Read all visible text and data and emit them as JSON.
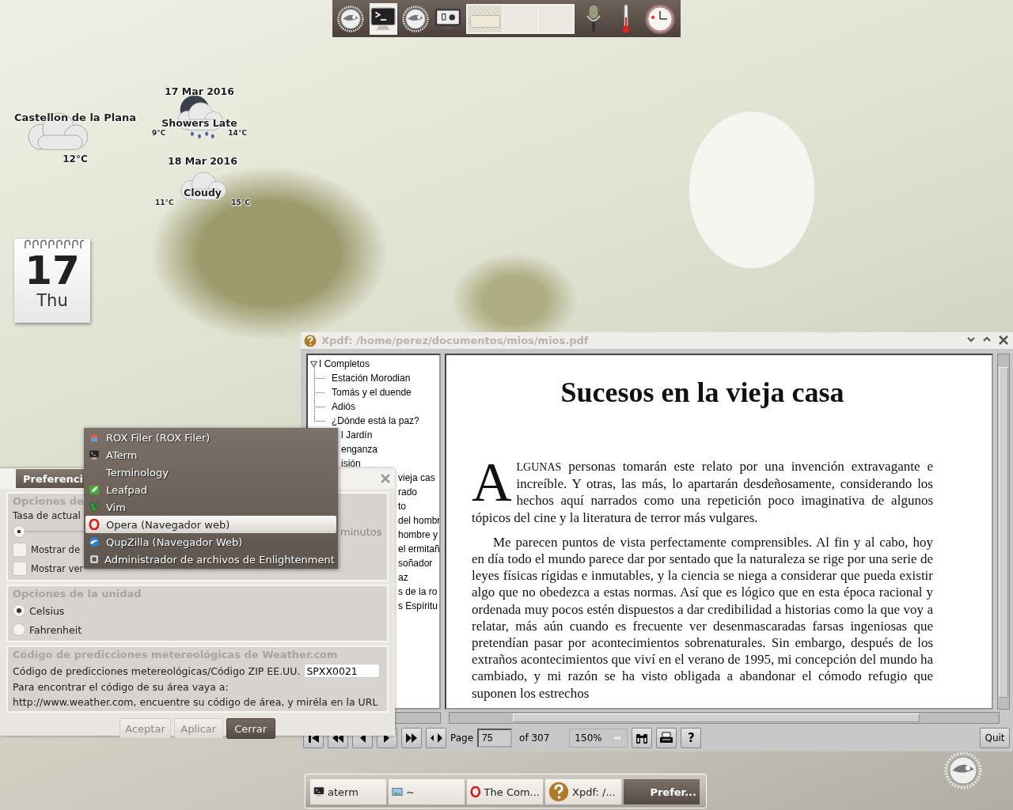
{
  "top_shelf": {
    "launchers": [
      {
        "kind": "gecko",
        "selected": false
      },
      {
        "kind": "terminal",
        "selected": true
      },
      {
        "kind": "gecko",
        "selected": false
      },
      {
        "kind": "monitor",
        "selected": false
      }
    ],
    "pager": [
      {
        "selected": true
      },
      {
        "selected": false
      },
      {
        "selected": false
      }
    ],
    "gadgets": [
      {
        "kind": "microphone"
      },
      {
        "kind": "thermometer"
      },
      {
        "kind": "clock"
      }
    ]
  },
  "weather": {
    "location": "Castellon de la Plana",
    "temperature": "12°C",
    "forecast": [
      {
        "date": "17 Mar 2016",
        "condition": "Showers Late",
        "kind": "rain",
        "low": "9°C",
        "high": "14°C"
      },
      {
        "date": "18 Mar 2016",
        "condition": "Cloudy",
        "kind": "cloud",
        "low": "11°C",
        "high": "15°C"
      }
    ]
  },
  "calendar": {
    "day": "17",
    "weekday": "Thu"
  },
  "xpdf": {
    "title": "Xpdf: /home/perez/documentos/mios/mios.pdf",
    "outline": [
      {
        "label": "I Completos",
        "expanded": true,
        "children": [
          {
            "label": "Estación Morodian",
            "kind": "entry"
          },
          {
            "label": "Tomás y el duende",
            "kind": "entry"
          },
          {
            "label": "Adiós",
            "kind": "entry"
          },
          {
            "label": "¿Dónde está la paz?",
            "kind": "entry"
          },
          {
            "label": "l Jardín",
            "kind": "partial"
          },
          {
            "label": "enganza",
            "kind": "partial"
          },
          {
            "label": "isión",
            "kind": "partial"
          },
          {
            "label": "vieja cas",
            "kind": "partial"
          },
          {
            "label": "rado",
            "kind": "partial"
          },
          {
            "label": "to",
            "kind": "partial"
          },
          {
            "label": "del hombr",
            "kind": "partial"
          },
          {
            "label": "hombre y",
            "kind": "partial"
          },
          {
            "label": "el ermitañ",
            "kind": "partial"
          },
          {
            "label": "soñador",
            "kind": "partial"
          },
          {
            "label": "az",
            "kind": "partial"
          },
          {
            "label": "s de la ro",
            "kind": "partial"
          },
          {
            "label": "s Espíritu",
            "kind": "partial"
          }
        ]
      }
    ],
    "page": {
      "title": "Sucesos en la vieja casa",
      "paragraphs": [
        {
          "dropcap": "A",
          "smallcaps": "LGUNAS",
          "text": " personas tomarán este relato por una invención extravagante e increíble. Y otras, las más, lo apartarán desdeñosamente, considerando los hechos aquí narrados como una repetición poco imaginativa de algunos tópicos del cine y la literatura de terror más vulgares."
        },
        {
          "text": "Me parecen puntos de vista perfectamente comprensibles. Al fin y al cabo, hoy en día todo el mundo parece dar por sentado que la naturaleza se rige por una serie de leyes físicas rígidas e inmutables, y la ciencia se niega a considerar que pueda existir algo que no obedezca a estas normas. Así que es lógico que en esta época racional y ordenada muy pocos estén dispuestos a dar credibilidad a historias como la que voy a relatar, más aún cuando es frecuente ver desenmascaradas farsas ingeniosas que pretendían pasar por acontecimientos sobrenaturales. Sin embargo, después de los extraños acontecimientos que viví en el verano de 1995, mi concepción del mundo ha cambiado, y mi razón se ha visto obligada a abandonar el cómodo refugio que suponen los estrechos"
        }
      ]
    },
    "toolbar": {
      "page_label": "Page",
      "page": "75",
      "page_count": "of 307",
      "zoom": "150%",
      "help": "?",
      "quit": "Quit"
    }
  },
  "preferences": {
    "title": "Preferenci",
    "update": {
      "heading": "Opciones de",
      "label": "Tasa de actual",
      "level": 0,
      "unit": "minutos",
      "checkboxes": [
        {
          "label": "Mostrar de",
          "checked": false
        },
        {
          "label": "Mostrar ver",
          "checked": false
        }
      ]
    },
    "units": {
      "heading": "Opciones de la unidad",
      "options": [
        {
          "label": "Celsius",
          "selected": true
        },
        {
          "label": "Fahrenheit",
          "selected": false
        }
      ]
    },
    "code": {
      "heading": "Código de predicciones metereológicas de Weather.com",
      "label": "Código de predicciones metereológicas/Código ZIP EE.UU.",
      "value": "SPXX0021",
      "hint": "Para encontrar el código de su área vaya a:",
      "url_text": "http://www.weather.com, encuentre su código de área, y miréla en la URL"
    },
    "buttons": [
      {
        "label": "Aceptar",
        "focused": false
      },
      {
        "label": "Aplicar",
        "focused": false
      },
      {
        "label": "Cerrar",
        "focused": true
      }
    ]
  },
  "menu": {
    "items": [
      {
        "label": "ROX Filer (ROX Filer)",
        "kind": "house",
        "selected": false
      },
      {
        "label": "ATerm",
        "kind": "terminal",
        "selected": false
      },
      {
        "label": "Terminology",
        "kind": "none",
        "selected": false
      },
      {
        "label": "Leafpad",
        "kind": "leaf",
        "selected": false
      },
      {
        "label": "Vim",
        "kind": "vim",
        "selected": false
      },
      {
        "label": "Opera (Navegador web)",
        "kind": "opera",
        "selected": true
      },
      {
        "label": "QupZilla (Navegador Web)",
        "kind": "wave",
        "selected": false
      },
      {
        "label": "Administrador de archivos de Enlightenment",
        "kind": "files",
        "selected": false
      }
    ]
  },
  "taskbar": {
    "items": [
      {
        "label": "aterm",
        "kind": "terminal",
        "selected": false
      },
      {
        "label": "~",
        "kind": "photo",
        "selected": false
      },
      {
        "label": "The Com...",
        "kind": "opera",
        "selected": false
      },
      {
        "label": "Xpdf: /...",
        "kind": "help",
        "selected": false
      },
      {
        "label": "Prefer...",
        "kind": "none",
        "selected": true
      }
    ]
  }
}
